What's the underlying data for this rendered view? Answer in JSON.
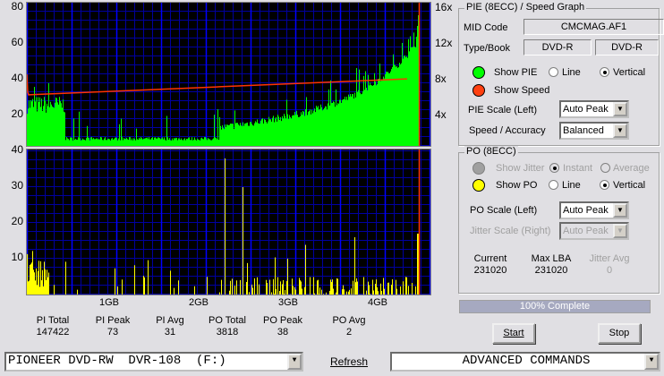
{
  "pie_axis": {
    "left": [
      "80",
      "60",
      "40",
      "20"
    ],
    "right": [
      "16x",
      "12x",
      "8x",
      "4x"
    ]
  },
  "po_axis": {
    "left": [
      "40",
      "30",
      "20",
      "10"
    ]
  },
  "x_labels": [
    "1GB",
    "2GB",
    "3GB",
    "4GB"
  ],
  "stats": [
    {
      "label": "PI Total",
      "value": "147422"
    },
    {
      "label": "PI Peak",
      "value": "73"
    },
    {
      "label": "PI Avg",
      "value": "31"
    },
    {
      "label": "PO Total",
      "value": "3818"
    },
    {
      "label": "PO Peak",
      "value": "38"
    },
    {
      "label": "PO Avg",
      "value": "2"
    }
  ],
  "pie_group": {
    "title": "PIE (8ECC) / Speed Graph",
    "mid_label": "MID Code",
    "mid_value": "CMCMAG.AF1",
    "type_label": "Type/Book",
    "type_value": "DVD-R",
    "book_value": "DVD-R",
    "show_pie": "Show PIE",
    "line": "Line",
    "vertical": "Vertical",
    "show_speed": "Show Speed",
    "scale_label": "PIE Scale (Left)",
    "scale_value": "Auto Peak",
    "accuracy_label": "Speed / Accuracy",
    "accuracy_value": "Balanced"
  },
  "po_group": {
    "title": "PO (8ECC)",
    "show_jitter": "Show Jitter",
    "instant": "Instant",
    "average": "Average",
    "show_po": "Show PO",
    "line": "Line",
    "vertical": "Vertical",
    "scale_label": "PO Scale (Left)",
    "scale_value": "Auto Peak",
    "jitter_scale_label": "Jitter Scale (Right)",
    "jitter_scale_value": "Auto Peak",
    "current_label": "Current",
    "current_value": "231020",
    "maxlba_label": "Max LBA",
    "maxlba_value": "231020",
    "jitter_avg_label": "Jitter Avg",
    "jitter_avg_value": "0"
  },
  "progress": {
    "text": "100% Complete",
    "percent": 100
  },
  "buttons": {
    "start": "Start",
    "stop": "Stop",
    "refresh": "Refresh"
  },
  "drive": "PIONEER DVD-RW  DVR-108  (F:)",
  "advanced": "ADVANCED COMMANDS",
  "colors": {
    "pie": "#00ff00",
    "po": "#ffff00",
    "speed": "#ff3300",
    "grid": "#0000ff"
  }
}
